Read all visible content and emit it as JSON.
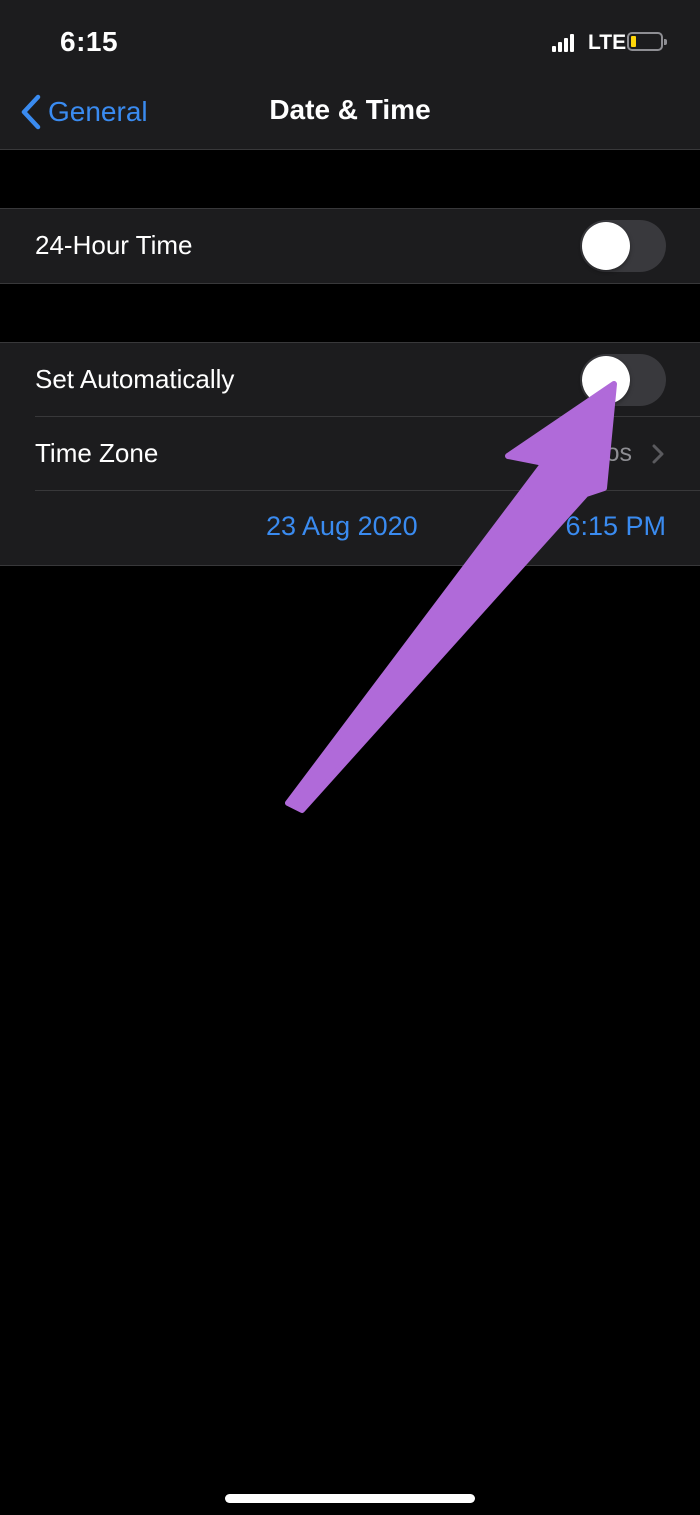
{
  "status_bar": {
    "time": "6:15",
    "network": "LTE",
    "battery_level": 0.15,
    "battery_color": "#ffd60a"
  },
  "nav": {
    "back_label": "General",
    "title": "Date & Time"
  },
  "settings": {
    "hour24": {
      "label": "24-Hour Time",
      "on": false
    },
    "set_automatically": {
      "label": "Set Automatically",
      "on": false
    },
    "time_zone": {
      "label": "Time Zone",
      "value": "os"
    },
    "date": "23 Aug 2020",
    "time": "6:15 PM"
  },
  "annotation": {
    "arrow_color": "#b06ad9"
  },
  "colors": {
    "accent": "#3a8bf0",
    "background": "#000000",
    "cell": "#1c1c1e"
  }
}
